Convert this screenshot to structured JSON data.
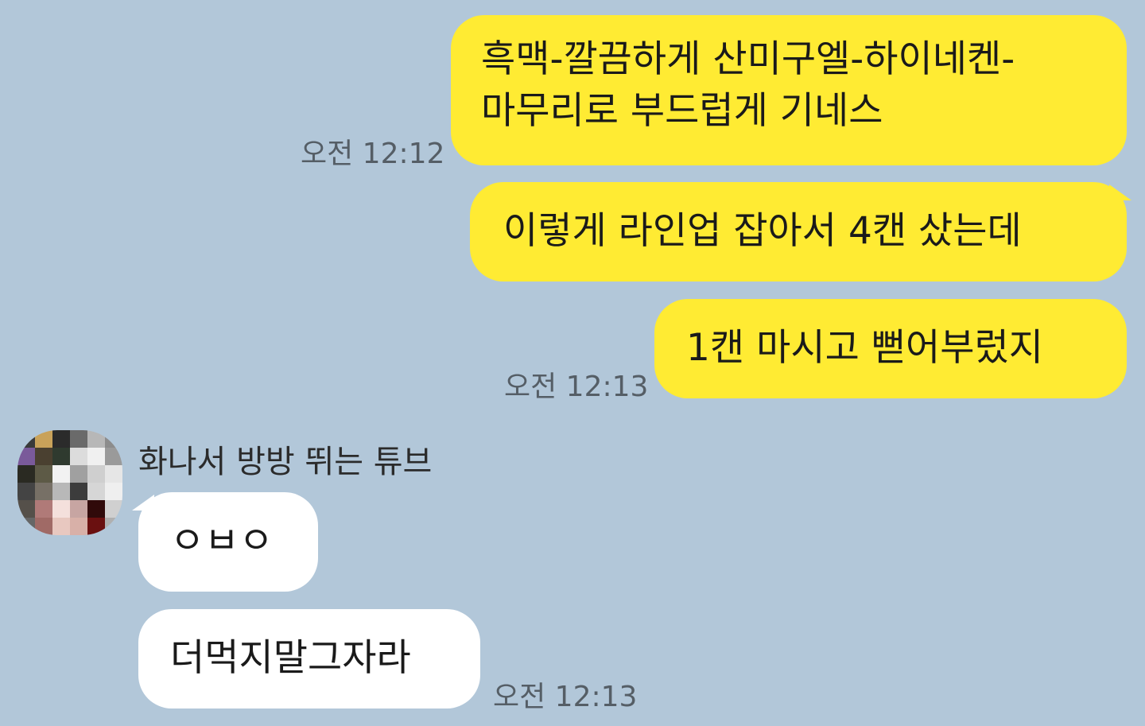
{
  "messages_sent": [
    {
      "text": "흑맥-깔끔하게 산미구엘-하이네켄-\n마무리로 부드럽게 기네스",
      "time": "오전 12:12"
    },
    {
      "text": "이렇게 라인업 잡아서 4캔 샀는데",
      "time": ""
    },
    {
      "text": "1캔 마시고 뻗어부렀지",
      "time": "오전 12:13"
    }
  ],
  "received": {
    "sender_name": "화나서 방방 뛰는 튜브",
    "avatar_icon": "pixelated-profile-avatar",
    "messages": [
      {
        "text": "ㅇㅂㅇ",
        "time": ""
      },
      {
        "text": "더먹지말그자라",
        "time": "오전 12:13"
      }
    ]
  },
  "colors": {
    "background": "#b2c7d9",
    "sent_bubble": "#ffeb33",
    "received_bubble": "#ffffff",
    "timestamp": "#555e66"
  }
}
